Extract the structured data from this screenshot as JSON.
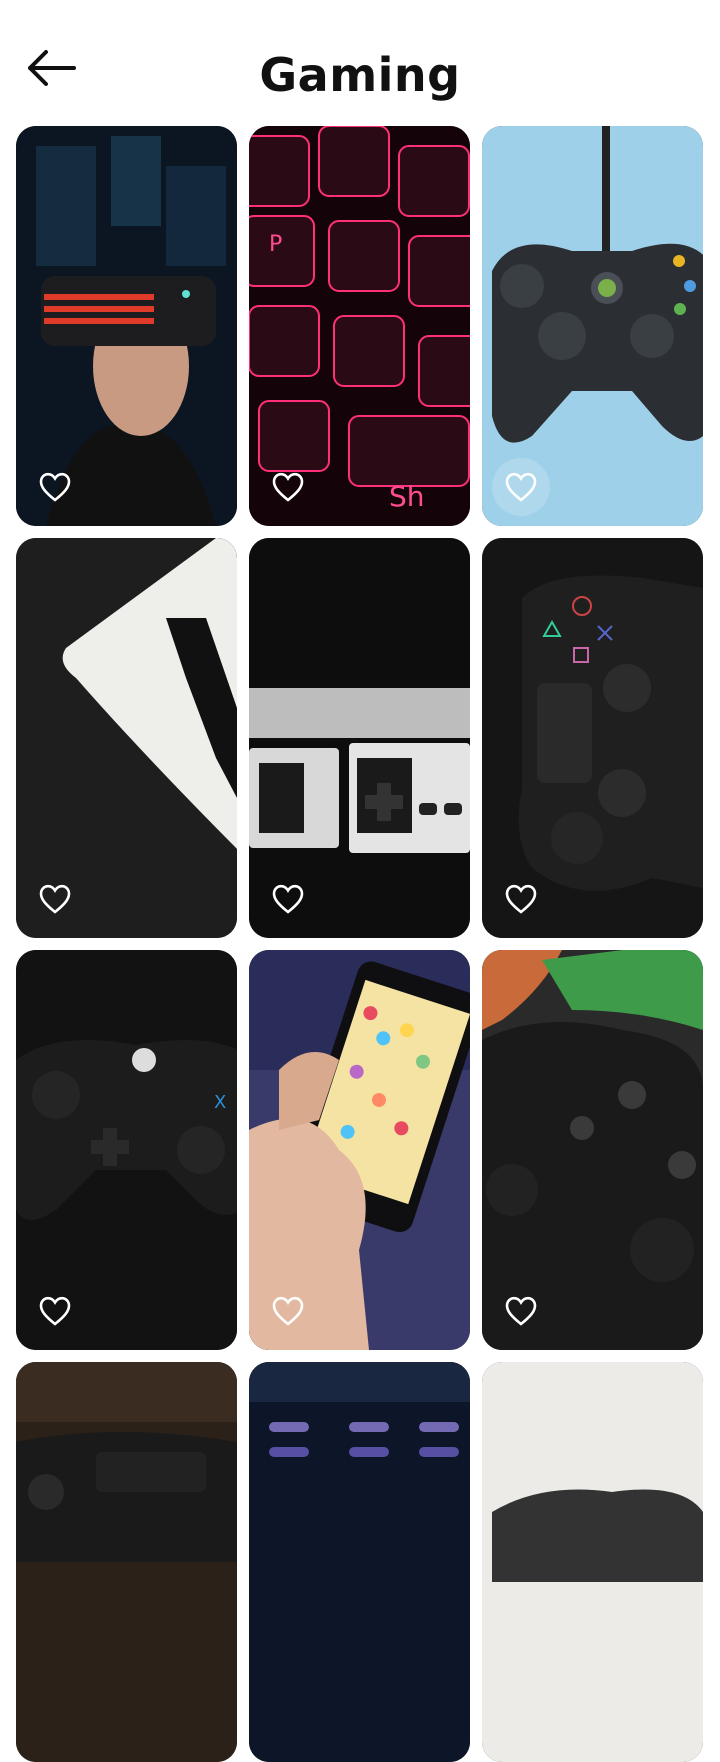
{
  "header": {
    "title": "Gaming",
    "back_icon": "arrow-left-icon"
  },
  "wallpapers": [
    {
      "subject": "vr-headset-man",
      "favorite": false
    },
    {
      "subject": "neon-keyboard",
      "favorite": false
    },
    {
      "subject": "xbox-controller-blue",
      "favorite": false
    },
    {
      "subject": "card-letter-a",
      "favorite": false
    },
    {
      "subject": "nes-controllers",
      "favorite": false
    },
    {
      "subject": "ps4-controller",
      "favorite": false
    },
    {
      "subject": "xbox-controller-dark",
      "favorite": false
    },
    {
      "subject": "phone-candy-game",
      "favorite": false
    },
    {
      "subject": "xbox-one-controller",
      "favorite": false
    },
    {
      "subject": "controller-wood",
      "favorite": false
    },
    {
      "subject": "blur-keyboard",
      "favorite": false
    },
    {
      "subject": "controller-light",
      "favorite": false
    }
  ],
  "colors": {
    "heart": "#ffffff",
    "title": "#111111"
  }
}
